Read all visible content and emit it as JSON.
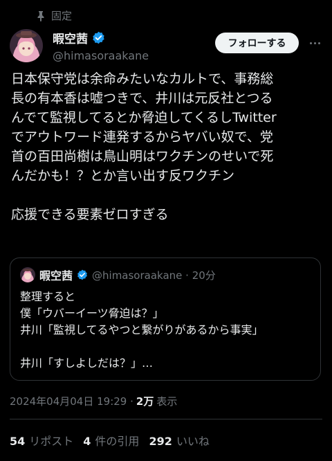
{
  "pinned_label": "固定",
  "author": {
    "name": "暇空茜",
    "handle": "@himasoraakane",
    "verified_color": "#1d9bf0"
  },
  "follow_button": "フォローする",
  "tweet_text": "日本保守党は余命みたいなカルトで、事務総\n長の有本香は嘘つきで、井川は元反社とつる\nんでて監視してるとか脅迫してくるしTwitter\nでアウトワード連発するからヤバい奴で、党\n首の百田尚樹は鳥山明はワクチンのせいで死\nんだかも！？とか言い出す反ワクチン\n\n応援できる要素ゼロすぎる",
  "quote": {
    "name": "暇空茜",
    "handle_time": "@himasoraakane · 20分",
    "text": "整理すると\n僕「ウバーイーツ脅迫は？」\n井川「監視してるやつと繋がりがあるから事実」\n\n井川「すしよしだは？」…"
  },
  "meta": {
    "timestamp": "2024年04月04日 19:29 ·",
    "views_count": "2万",
    "views_label": "表示"
  },
  "stats": [
    {
      "count": "54",
      "label": "リポスト"
    },
    {
      "count": "4",
      "label": "件の引用"
    },
    {
      "count": "292",
      "label": "いいね"
    }
  ],
  "icons": {
    "pin": "pin-icon",
    "verified": "verified-badge-icon",
    "more": "more-options-icon"
  }
}
